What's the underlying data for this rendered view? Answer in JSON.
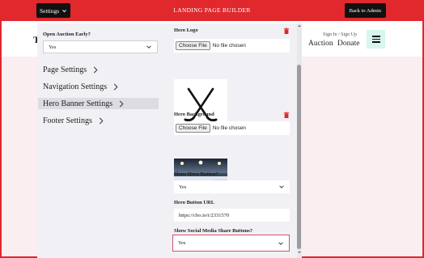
{
  "topbar": {
    "settings_label": "Settings",
    "title": "LANDING PAGE BUILDER",
    "back_label": "Back to Admin"
  },
  "site": {
    "logo_letter": "T",
    "signin": "Sign In / Sign Up",
    "nav": [
      "Auction",
      "Donate"
    ]
  },
  "left_panel": {
    "open_auction_label": "Open Auction Early?",
    "open_auction_value": "Yes",
    "menu": [
      {
        "label": "Page Settings",
        "active": false
      },
      {
        "label": "Navigation Settings",
        "active": false
      },
      {
        "label": "Hero Banner Settings",
        "active": true
      },
      {
        "label": "Footer Settings",
        "active": false
      }
    ]
  },
  "right_panel": {
    "hero_logo_label": "Hero Logo",
    "choose_file": "Choose File",
    "no_file": "No file chosen",
    "hero_background_label": "Hero Background",
    "show_hero_button_label": "Show Hero Button?",
    "show_hero_button_value": "Yes",
    "hero_button_url_label": "Hero Button URL",
    "hero_button_url_value": "https://cbo.io/i/2331570",
    "show_social_label": "Show Social Media Share Buttons?",
    "show_social_value": "Yes"
  },
  "colors": {
    "brand_red": "#e0282d",
    "panel_bg": "#f1f1f5",
    "hamburger_bg": "#d6f6ee",
    "trash_red": "#d92b2b",
    "focus_border": "#c9566a"
  },
  "icons": [
    "chevron-down-icon",
    "chevron-right-icon",
    "trash-icon",
    "hamburger-icon",
    "hockey-sticks-logo"
  ]
}
